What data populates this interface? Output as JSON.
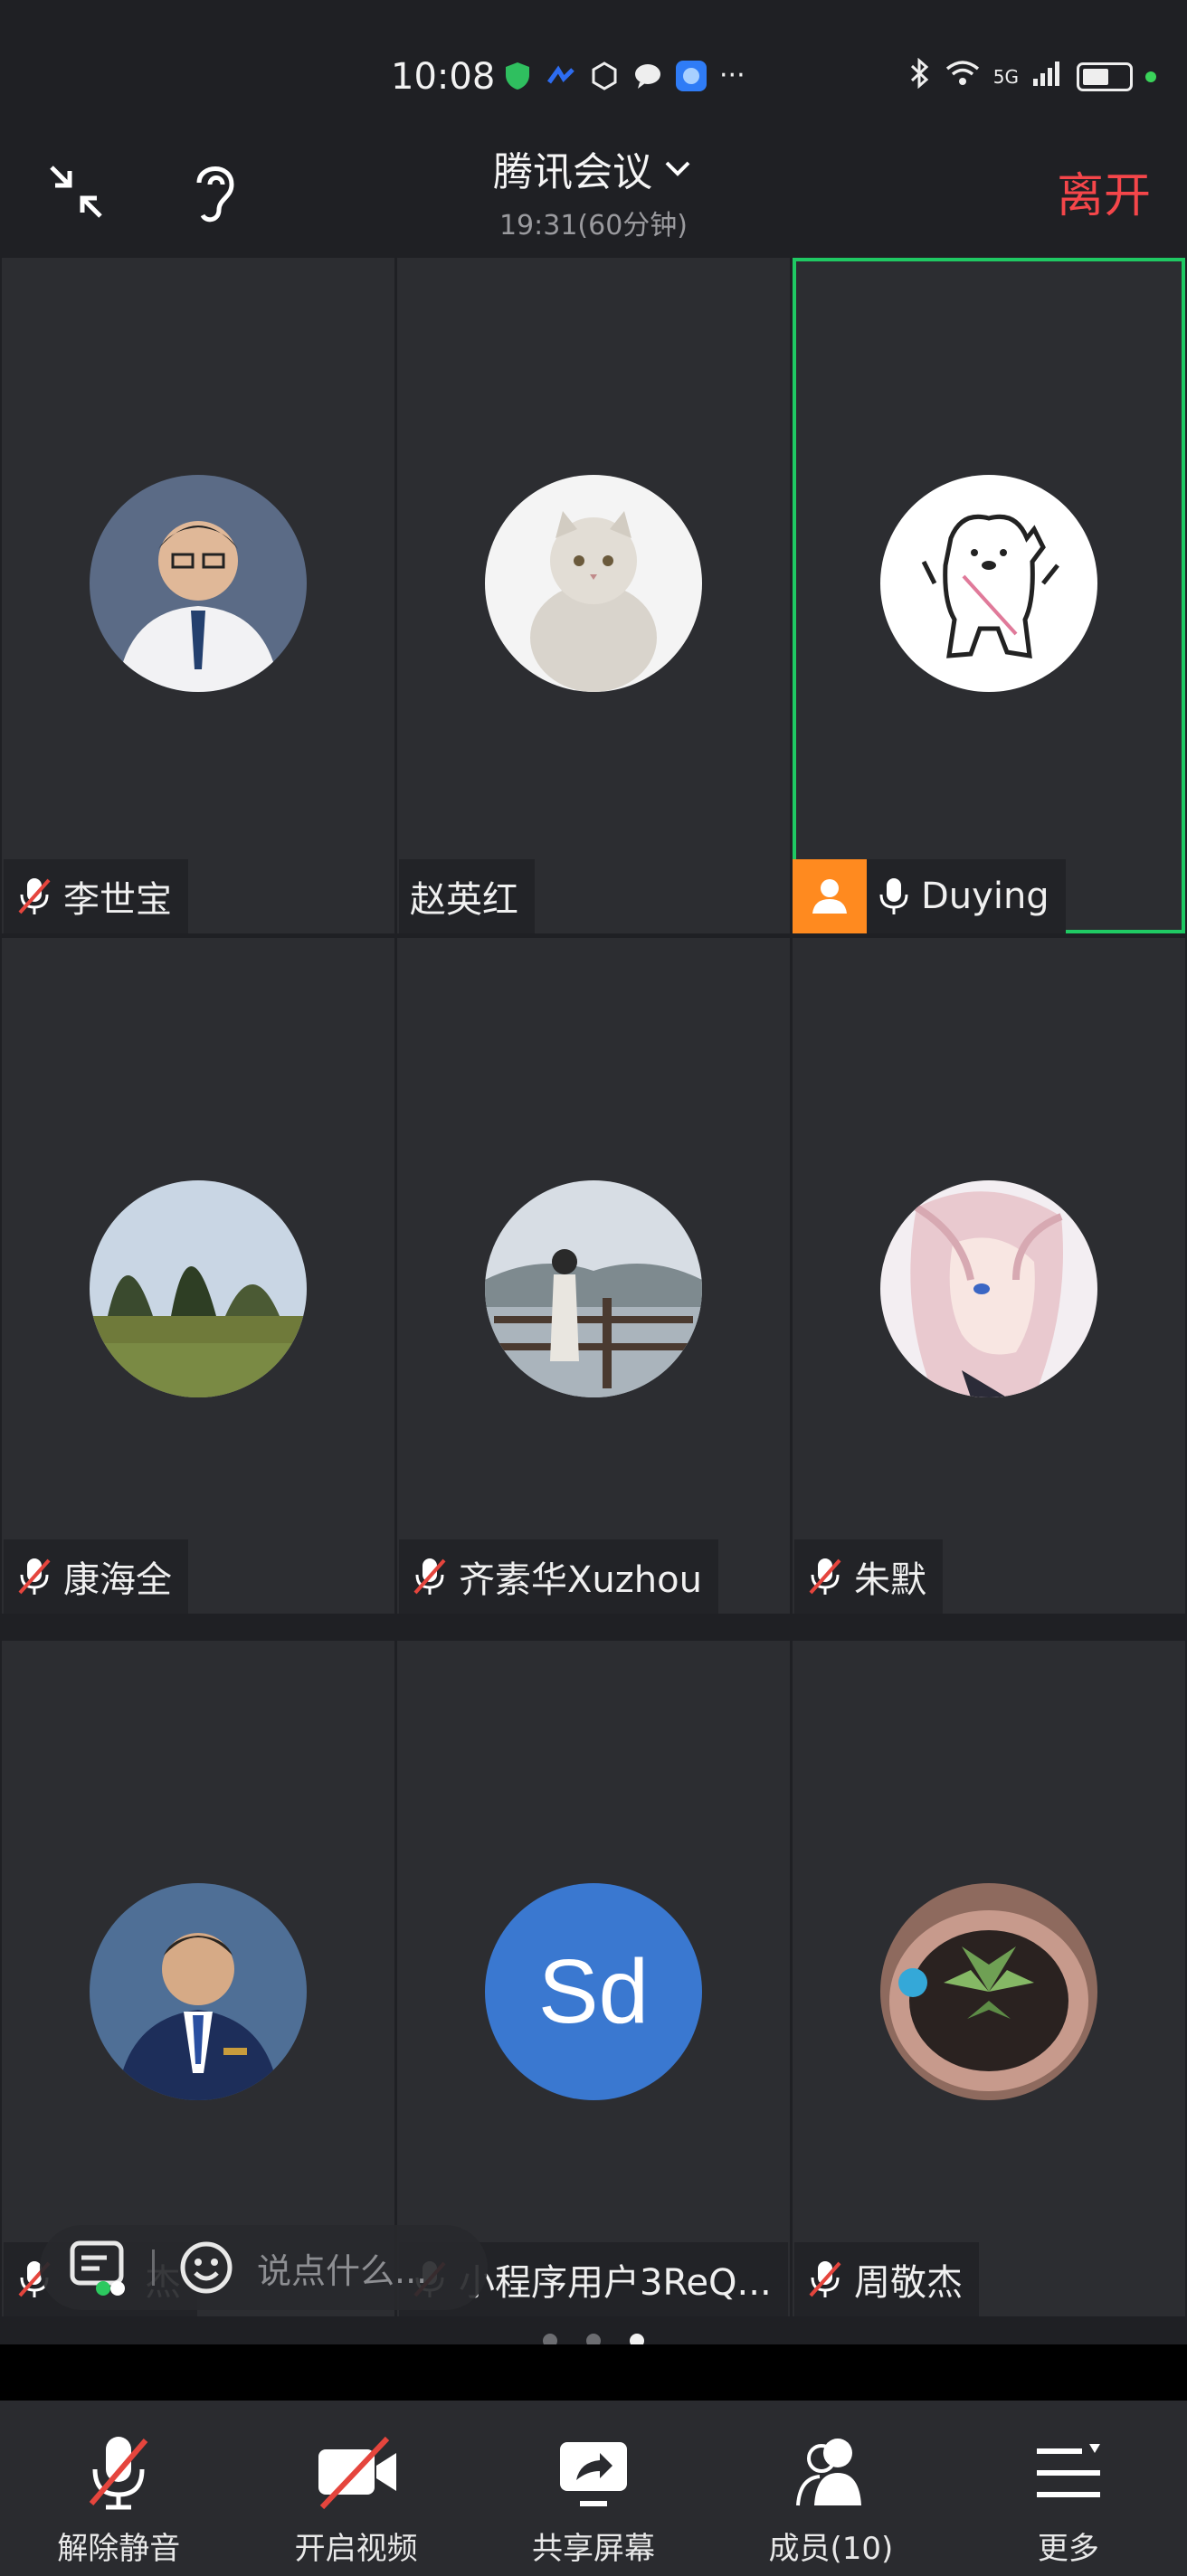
{
  "status_bar": {
    "time": "10:08",
    "network": "5G",
    "icons": [
      "shield-icon",
      "swoosh-icon",
      "hexagon-icon",
      "chat-bubble-icon",
      "app-icon",
      "more-icon",
      "bluetooth-icon",
      "wifi-icon",
      "signal-icon",
      "battery-icon"
    ],
    "battery_level": 0.55
  },
  "header": {
    "title": "腾讯会议",
    "subtitle": "19:31(60分钟)",
    "leave_label": "离开",
    "leave_color": "#f5464a"
  },
  "participants": [
    {
      "name": "李世宝",
      "muted": true,
      "avatar": "person-photo"
    },
    {
      "name": "赵英红",
      "muted": false,
      "avatar": "cat-photo"
    },
    {
      "name": "Duying",
      "muted": false,
      "speaking": true,
      "avatar": "bear-sticker"
    },
    {
      "name": "康海全",
      "muted": true,
      "avatar": "landscape-photo"
    },
    {
      "name": "齐素华Xuzhou",
      "muted": true,
      "avatar": "lakeside-photo"
    },
    {
      "name": "朱默",
      "muted": true,
      "avatar": "anime-photo"
    },
    {
      "name": "杰",
      "muted": true,
      "avatar": "man-suit-photo"
    },
    {
      "name": "小程序用户3ReQ...",
      "muted": true,
      "avatar": "initials",
      "initials": "Sd"
    },
    {
      "name": "周敬杰",
      "muted": true,
      "avatar": "succulent-photo"
    }
  ],
  "chat": {
    "placeholder": "说点什么..."
  },
  "pager": {
    "pages": 3,
    "current": 3
  },
  "toolbar": {
    "unmute": "解除静音",
    "video": "开启视频",
    "share": "共享屏幕",
    "members": "成员(10)",
    "more": "更多"
  },
  "colors": {
    "accent_green": "#1fc963",
    "orange": "#ff8a1f",
    "initials_bg": "#3a78d0"
  }
}
